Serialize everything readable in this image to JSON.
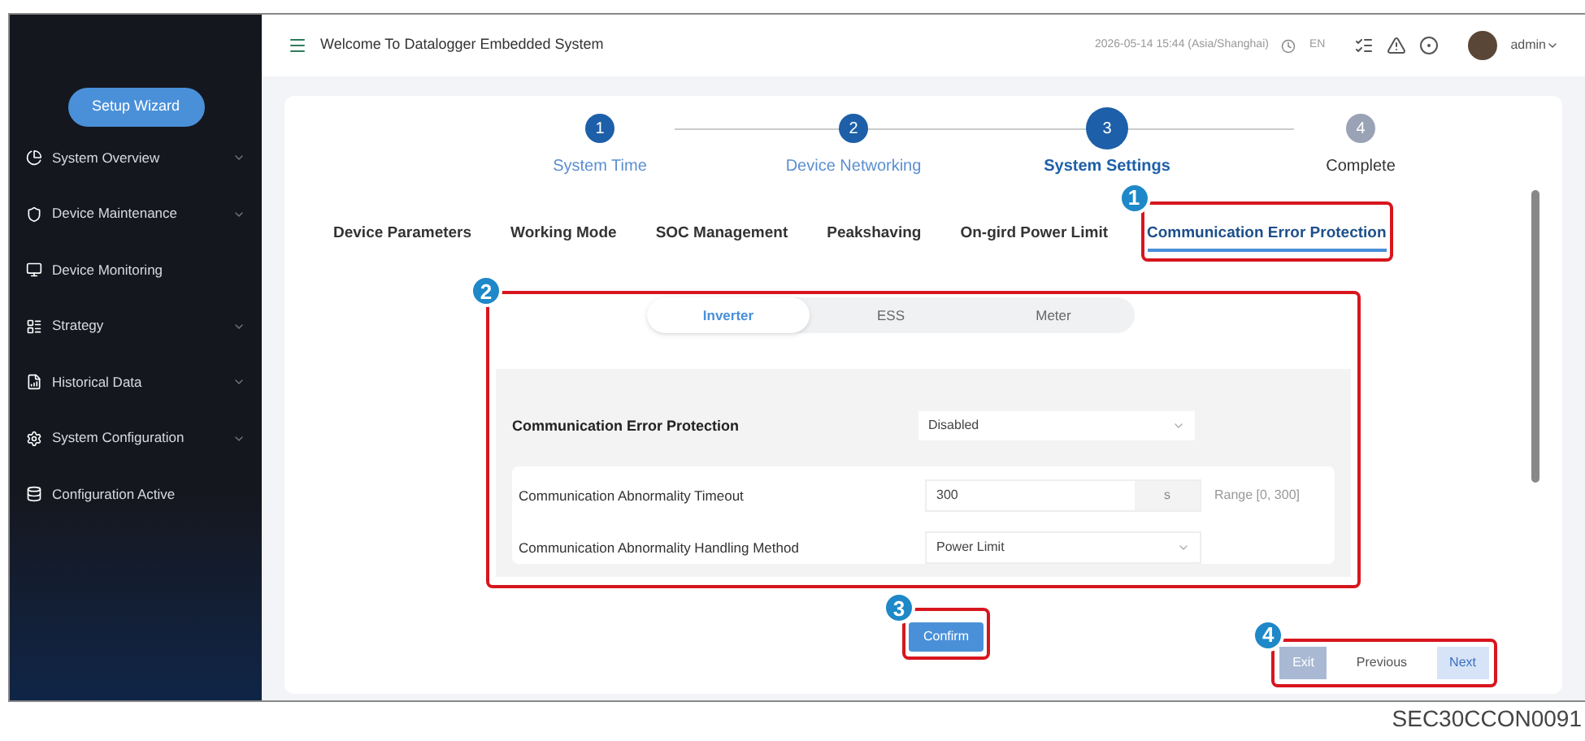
{
  "header": {
    "title": "Welcome To Datalogger Embedded System",
    "datetime": "2026-05-14 15:44 (Asia/Shanghai)",
    "language": "EN",
    "user": "admin"
  },
  "sidebar": {
    "wizard_button": "Setup Wizard",
    "items": [
      {
        "label": "System Overview",
        "expandable": true
      },
      {
        "label": "Device Maintenance",
        "expandable": true
      },
      {
        "label": "Device Monitoring",
        "expandable": false
      },
      {
        "label": "Strategy",
        "expandable": true
      },
      {
        "label": "Historical Data",
        "expandable": true
      },
      {
        "label": "System Configuration",
        "expandable": true
      },
      {
        "label": "Configuration Active",
        "expandable": false
      }
    ]
  },
  "steps": [
    {
      "number": "1",
      "label": "System Time",
      "completed": true,
      "selected": false
    },
    {
      "number": "2",
      "label": "Device Networking",
      "completed": true,
      "selected": false
    },
    {
      "number": "3",
      "label": "System Settings",
      "completed": false,
      "selected": true
    },
    {
      "number": "4",
      "label": "Complete",
      "completed": false,
      "selected": false
    }
  ],
  "tabs": {
    "callout": "1",
    "items": [
      {
        "label": "Device Parameters",
        "selected": false
      },
      {
        "label": "Working Mode",
        "selected": false
      },
      {
        "label": "SOC Management",
        "selected": false
      },
      {
        "label": "Peakshaving",
        "selected": false
      },
      {
        "label": "On-gird Power Limit",
        "selected": false
      },
      {
        "label": "Communication Error Protection",
        "selected": true
      }
    ]
  },
  "panel": {
    "callout": "2",
    "device_tabs": [
      {
        "label": "Inverter",
        "selected": true
      },
      {
        "label": "ESS",
        "selected": false
      },
      {
        "label": "Meter",
        "selected": false
      }
    ],
    "section": {
      "title": "Communication Error Protection",
      "value": "Disabled"
    },
    "fields": [
      {
        "kind": "input",
        "label": "Communication Abnormality Timeout",
        "value": "300",
        "unit": "s",
        "hint": "Range [0, 300]"
      },
      {
        "kind": "select",
        "label": "Communication Abnormality Handling Method",
        "value": "Power Limit"
      }
    ]
  },
  "confirm": {
    "callout": "3",
    "label": "Confirm"
  },
  "navigation": {
    "callout": "4",
    "buttons": [
      {
        "label": "Exit",
        "kind": "muted"
      },
      {
        "label": "Previous",
        "kind": "plain"
      },
      {
        "label": "Next",
        "kind": "primary"
      }
    ]
  },
  "figure_code": "SEC30CCON0091"
}
